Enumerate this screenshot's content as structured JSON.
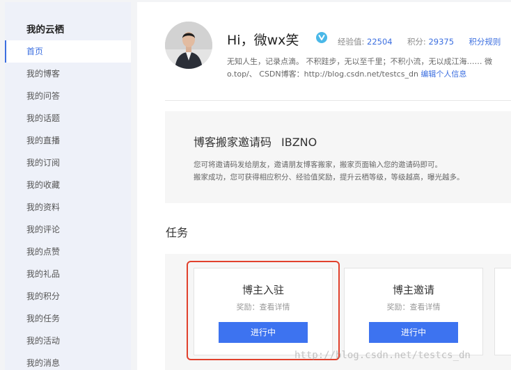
{
  "sidebar": {
    "title": "我的云栖",
    "items": [
      {
        "label": "首页",
        "active": true
      },
      {
        "label": "我的博客"
      },
      {
        "label": "我的问答"
      },
      {
        "label": "我的话题"
      },
      {
        "label": "我的直播"
      },
      {
        "label": "我的订阅"
      },
      {
        "label": "我的收藏"
      },
      {
        "label": "我的资料"
      },
      {
        "label": "我的评论"
      },
      {
        "label": "我的点赞"
      },
      {
        "label": "我的礼品"
      },
      {
        "label": "我的积分"
      },
      {
        "label": "我的任务"
      },
      {
        "label": "我的活动"
      },
      {
        "label": "我的消息"
      }
    ]
  },
  "profile": {
    "greeting": "Hi，微wx笑",
    "exp_label": "经验值:",
    "exp_value": "22504",
    "points_label": "积分:",
    "points_value": "29375",
    "points_rules": "积分规则",
    "bio_line1": "无知人生，记录点滴。 不积跬步，无以至千里；不积小流，无以成江海…… 微",
    "bio_line2": "o.top/、 CSDN博客：http://blog.csdn.net/testcs_dn",
    "edit_link": "编辑个人信息"
  },
  "invite": {
    "title": "博客搬家邀请码",
    "code": "IBZNO",
    "desc_line1": "您可将邀请码发给朋友，邀请朋友博客搬家，搬家页面输入您的邀请码即可。",
    "desc_line2": "搬家成功，您可获得相应积分、经验值奖励，提升云栖等级，等级越高，曝光越多。"
  },
  "tasks": {
    "heading": "任务",
    "items": [
      {
        "title": "博主入驻",
        "reward": "奖励：查看详情",
        "button": "进行中"
      },
      {
        "title": "博主邀请",
        "reward": "奖励：查看详情",
        "button": "进行中"
      }
    ]
  },
  "watermark": "http://blog.csdn.net/testcs_dn",
  "colors": {
    "accent": "#3c6fe0",
    "button": "#3d73f0",
    "highlight": "#e1402c",
    "sidebar_bg": "#eef1f9"
  }
}
